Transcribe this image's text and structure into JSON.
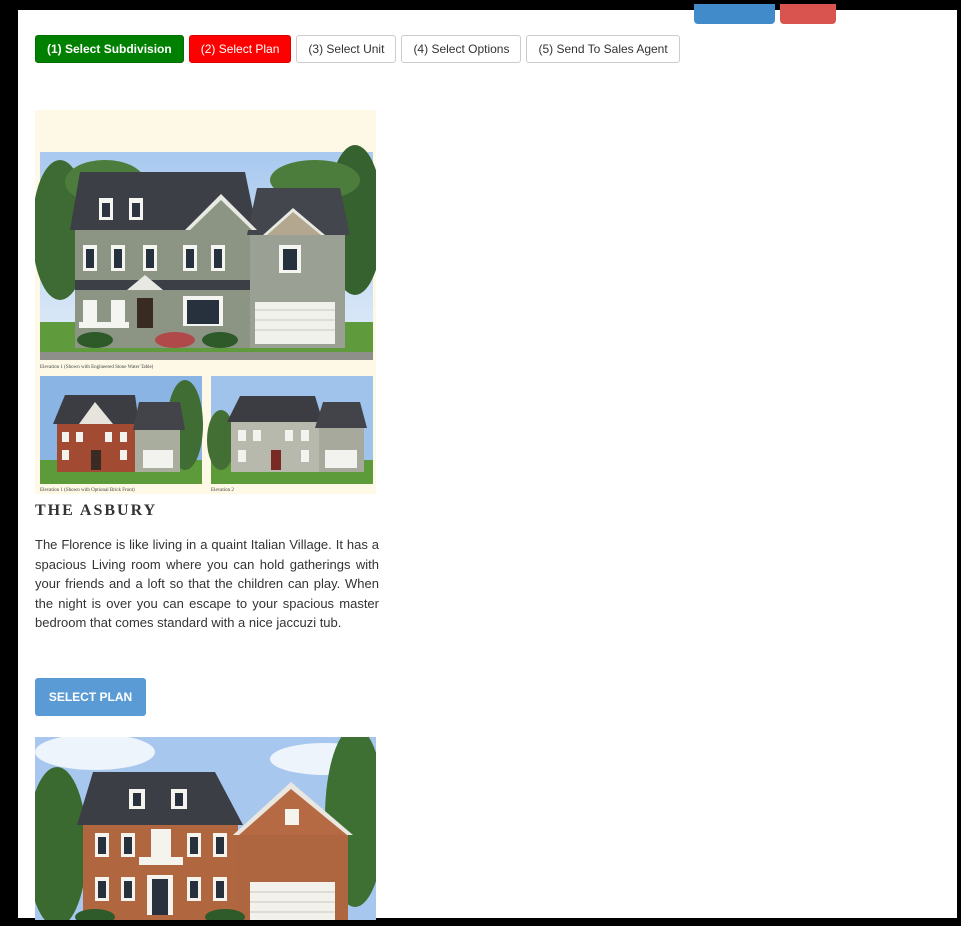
{
  "header": {
    "top_buttons": [
      {
        "label": ""
      },
      {
        "label": ""
      }
    ]
  },
  "steps": [
    {
      "label": "(1) Select Subdivision"
    },
    {
      "label": "(2) Select Plan"
    },
    {
      "label": "(3) Select Unit"
    },
    {
      "label": "(4) Select Options"
    },
    {
      "label": "(5) Send To Sales Agent"
    }
  ],
  "plan": {
    "title": "THE ASBURY",
    "description": "The Florence is like living in a quaint Italian Village. It has a spacious Living room where you can hold gatherings with your friends and a loft so that the children can play. When the night is over you can escape to your spacious master bedroom that comes standard with a nice jaccuzi tub.",
    "select_label": "SELECT PLAN",
    "elevation_captions": [
      "Elevation 1 (Shown with Engineered Stone Water Table)",
      "Elevation 1 (Shown with Optional Brick Front)",
      "Elevation 2"
    ]
  },
  "colors": {
    "step_done": "#008000",
    "step_active": "#ff0000",
    "select_button": "#5b9bd5"
  }
}
